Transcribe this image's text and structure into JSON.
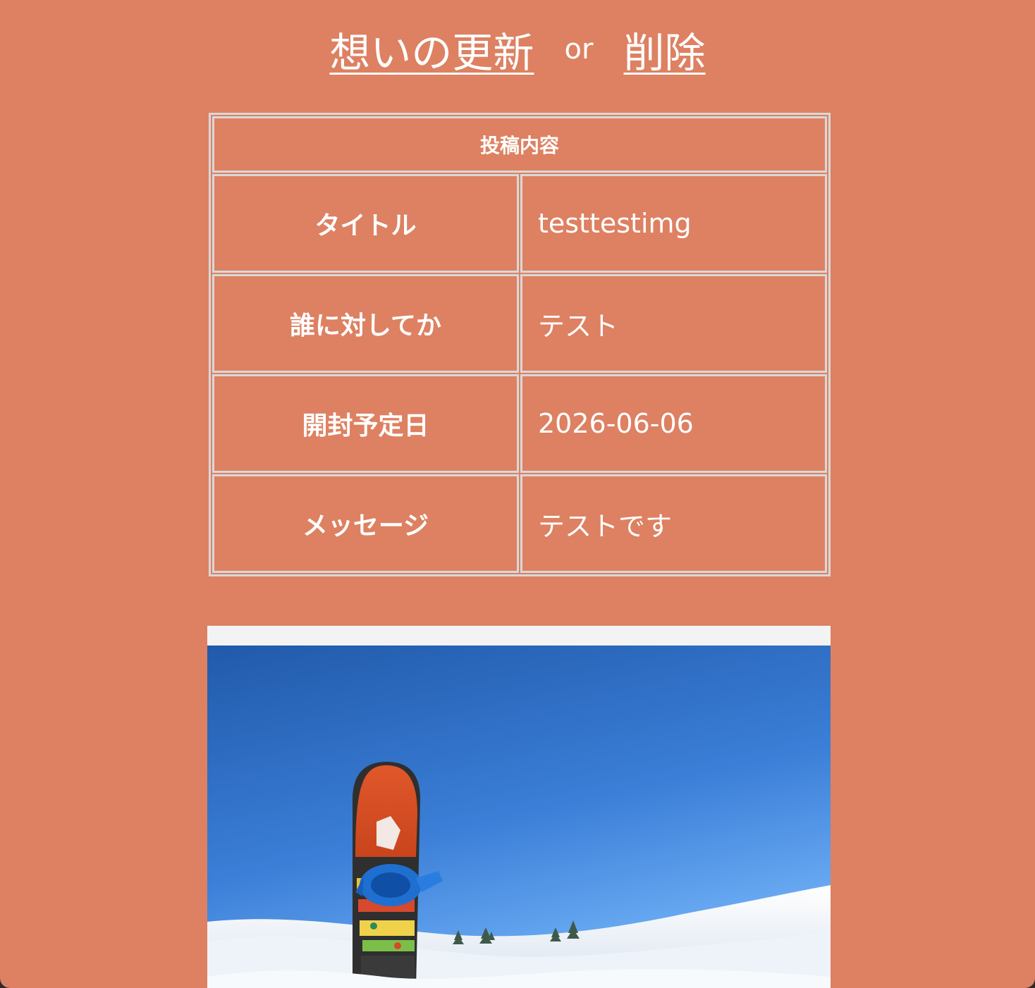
{
  "header": {
    "update_link": "想いの更新",
    "separator": "or",
    "delete_link": "削除"
  },
  "post": {
    "caption": "投稿内容",
    "rows": [
      {
        "label": "タイトル",
        "value": "testtestimg"
      },
      {
        "label": "誰に対してか",
        "value": "テスト"
      },
      {
        "label": "開封予定日",
        "value": "2026-06-06"
      },
      {
        "label": "メッセージ",
        "value": "テストです"
      }
    ]
  },
  "image": {
    "subject": "snowboard-in-snow-photo"
  },
  "colors": {
    "background": "#dd8162",
    "table_border": "#d8d8d8",
    "text": "#ffffff"
  }
}
